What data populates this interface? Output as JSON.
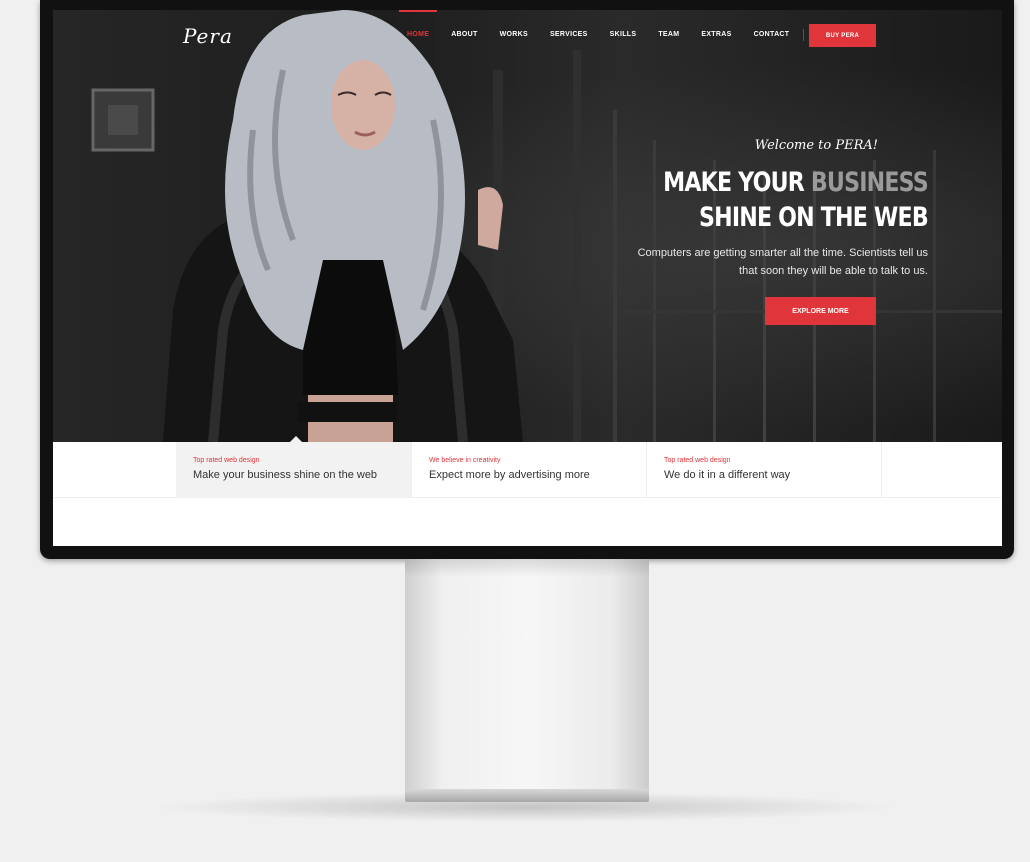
{
  "brand": {
    "logo": "Pera"
  },
  "nav": {
    "items": [
      {
        "label": "HOME",
        "active": true
      },
      {
        "label": "ABOUT"
      },
      {
        "label": "WORKS"
      },
      {
        "label": "SERVICES"
      },
      {
        "label": "SKILLS"
      },
      {
        "label": "TEAM"
      },
      {
        "label": "EXTRAS"
      },
      {
        "label": "CONTACT"
      }
    ],
    "social": [
      {
        "icon": "twitter-icon",
        "glyph": "🐦"
      },
      {
        "icon": "instagram-icon",
        "glyph": "◎"
      }
    ],
    "buy_label": "BUY PERA"
  },
  "hero": {
    "welcome": "Welcome to PERA!",
    "headline_line1_a": "MAKE YOUR ",
    "headline_line1_b": "BUSINESS",
    "headline_line2": "SHINE ON THE WEB",
    "description": "Computers are getting smarter all the time. Scientists tell us that soon they will be able to talk to us.",
    "cta_label": "EXPLORE MORE"
  },
  "features": [
    {
      "tag": "Top rated web design",
      "title": "Make your business shine on the web",
      "active": true
    },
    {
      "tag": "We believe in creativity",
      "title": "Expect more by advertising more"
    },
    {
      "tag": "Top rated web design",
      "title": "We do it in a different way"
    }
  ],
  "colors": {
    "accent": "#e0353a",
    "dark": "#1e1e1e",
    "page_bg": "#f0f0f0"
  }
}
